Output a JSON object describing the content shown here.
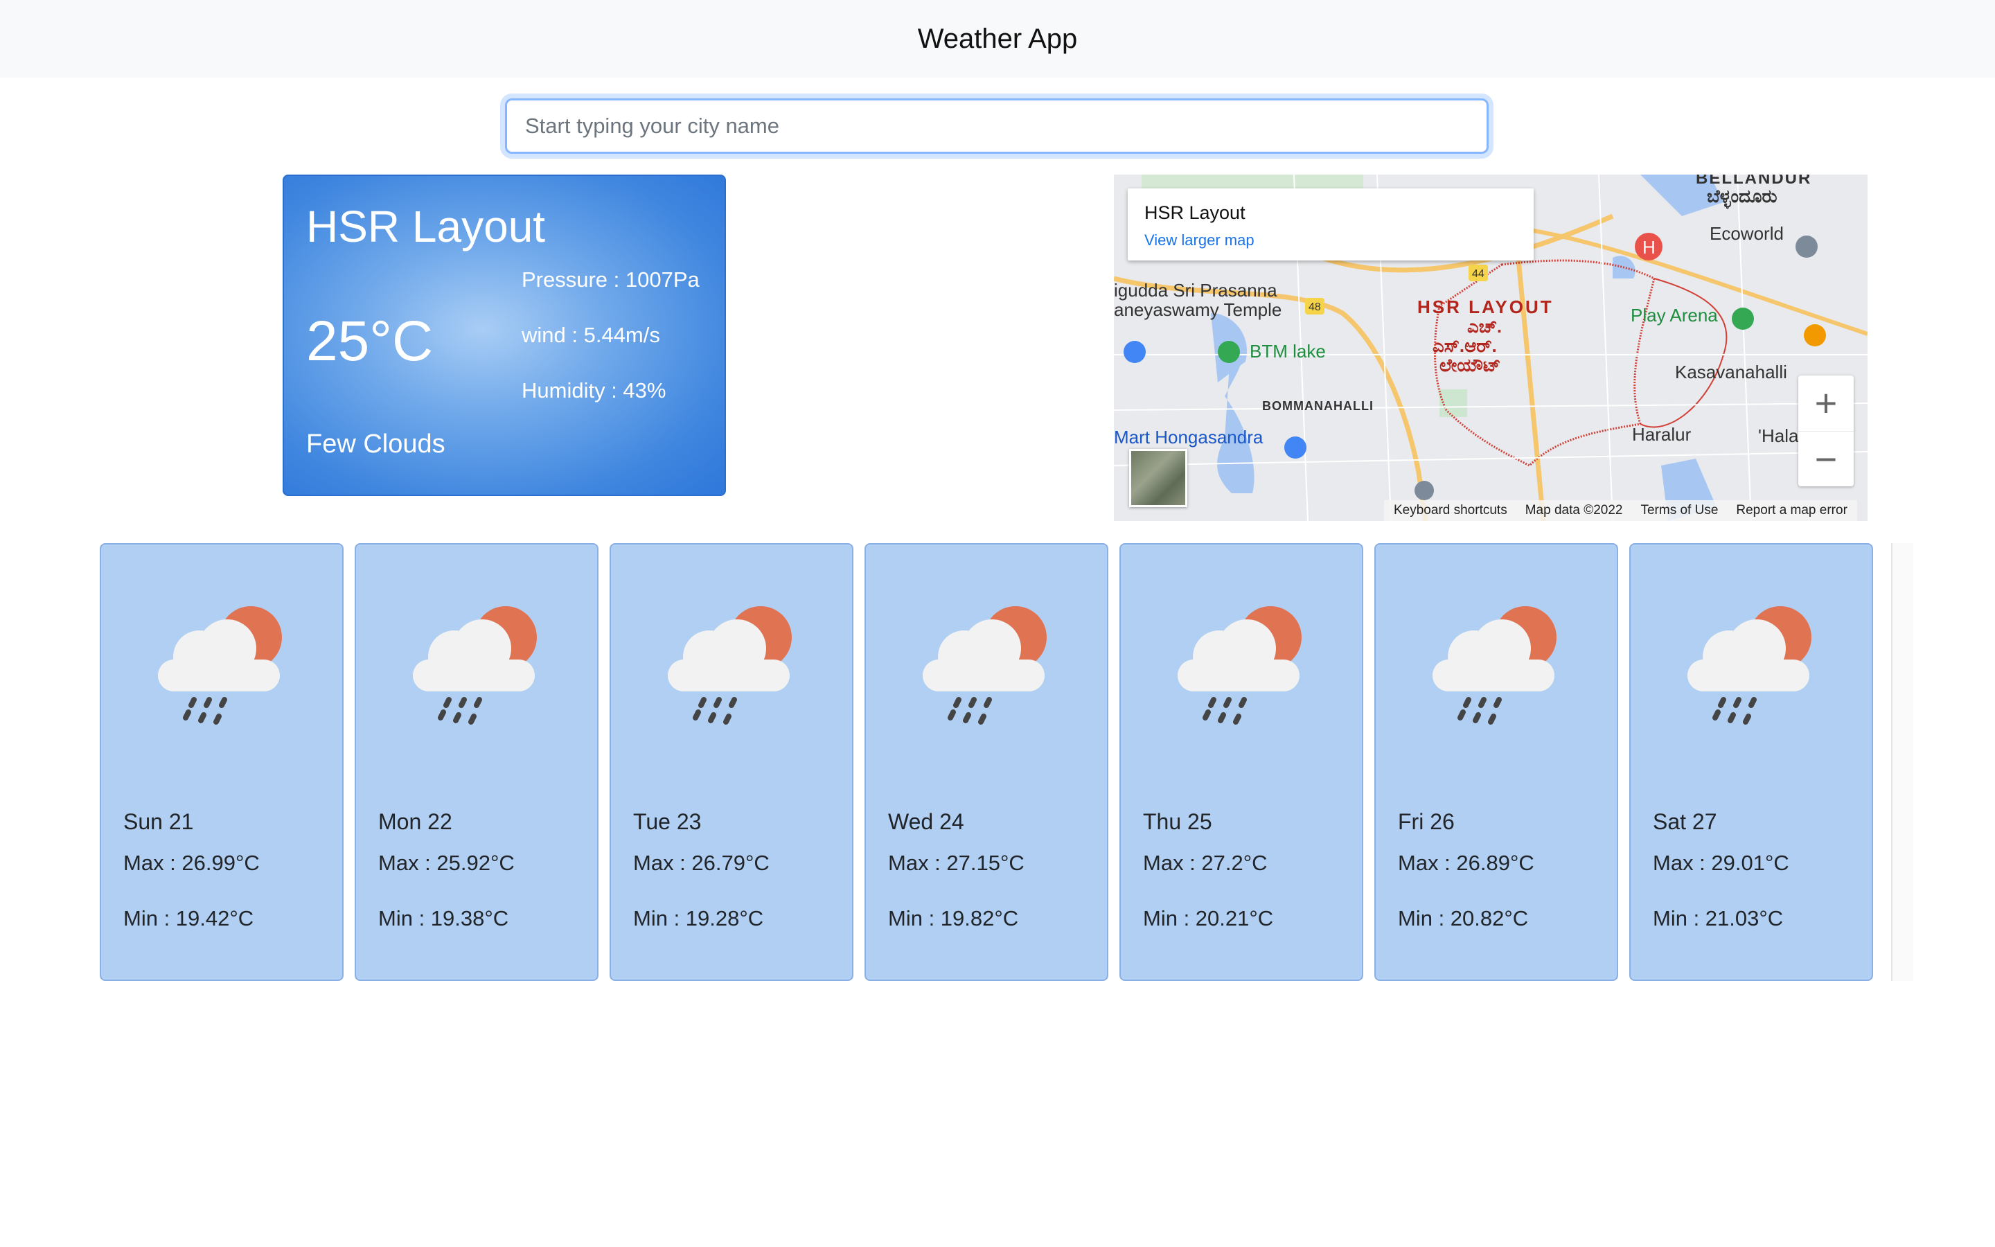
{
  "app": {
    "title": "Weather App"
  },
  "search": {
    "placeholder": "Start typing your city name",
    "value": ""
  },
  "current": {
    "city": "HSR Layout",
    "temperature": "25°C",
    "condition": "Few Clouds",
    "pressure": "Pressure : 1007Pa",
    "wind": "wind : 5.44m/s",
    "humidity": "Humidity : 43%"
  },
  "map": {
    "place_title": "HSR Layout",
    "larger_map_link": "View larger map",
    "labels": {
      "bellandur": "BELLANDUR",
      "bellandur_kn": "ಬೆಳ್ಳಂದೂರು",
      "ecoworld": "Ecoworld",
      "sri_prasanna": "igudda Sri Prasanna",
      "temple": "aneyaswamy Temple",
      "hsr": "HSR LAYOUT",
      "hsr_kn1": "ಎಚ್.",
      "hsr_kn2": "ಎಸ್.ಆರ್.",
      "hsr_kn3": "ಲೇಯೌಟ್",
      "btm": "BTM lake",
      "play_arena": "Play Arena",
      "kasavanahalli": "Kasavanahalli",
      "bommanahalli": "BOMMANAHALLI",
      "mart": "Mart Hongasandra",
      "haralur": "Haralur",
      "hala": "'Hala"
    },
    "road_badges": [
      "44",
      "48"
    ],
    "zoom_in": "+",
    "zoom_out": "−",
    "footer": {
      "shortcuts": "Keyboard shortcuts",
      "data": "Map data ©2022",
      "terms": "Terms of Use",
      "report": "Report a map error"
    }
  },
  "forecast": [
    {
      "day": "Sun 21",
      "max": "Max : 26.99°C",
      "min": "Min : 19.42°C",
      "icon": "rain-cloud-sun-icon"
    },
    {
      "day": "Mon 22",
      "max": "Max : 25.92°C",
      "min": "Min : 19.38°C",
      "icon": "rain-cloud-sun-icon"
    },
    {
      "day": "Tue 23",
      "max": "Max : 26.79°C",
      "min": "Min : 19.28°C",
      "icon": "rain-cloud-sun-icon"
    },
    {
      "day": "Wed 24",
      "max": "Max : 27.15°C",
      "min": "Min : 19.82°C",
      "icon": "rain-cloud-sun-icon"
    },
    {
      "day": "Thu 25",
      "max": "Max : 27.2°C",
      "min": "Min : 20.21°C",
      "icon": "rain-cloud-sun-icon"
    },
    {
      "day": "Fri 26",
      "max": "Max : 26.89°C",
      "min": "Min : 20.82°C",
      "icon": "rain-cloud-sun-icon"
    },
    {
      "day": "Sat 27",
      "max": "Max : 29.01°C",
      "min": "Min : 21.03°C",
      "icon": "rain-cloud-sun-icon"
    }
  ],
  "colors": {
    "header_bg": "#f8f9fa",
    "card_blue": "#3f86df",
    "forecast_card": "#b1cff2",
    "sun": "#e07352",
    "cloud": "#f2f2f2"
  }
}
